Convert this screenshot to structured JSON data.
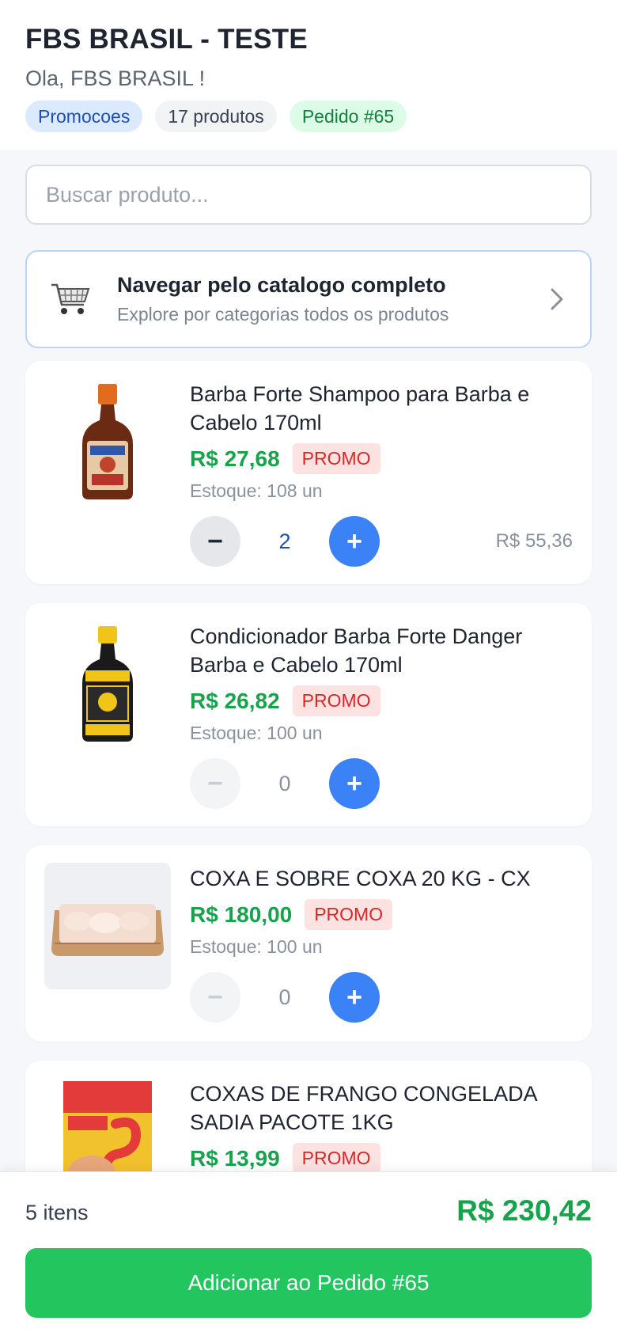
{
  "header": {
    "store_name": "FBS BRASIL - TESTE",
    "greeting": "Ola, FBS BRASIL !",
    "chips": [
      "Promocoes",
      "17 produtos",
      "Pedido #65"
    ]
  },
  "search": {
    "placeholder": "Buscar produto..."
  },
  "catalog": {
    "title": "Navegar pelo catalogo completo",
    "subtitle": "Explore por categorias todos os produtos"
  },
  "products": [
    {
      "name": "Barba Forte Shampoo para Barba e Cabelo 170ml",
      "price": "R$ 27,68",
      "badge": "PROMO",
      "stock": "Estoque: 108 un",
      "qty": "2",
      "subtotal": "R$ 55,36",
      "image": "shampoo-bottle"
    },
    {
      "name": "Condicionador Barba Forte Danger Barba e Cabelo 170ml",
      "price": "R$ 26,82",
      "badge": "PROMO",
      "stock": "Estoque: 100 un",
      "qty": "0",
      "image": "conditioner-bottle"
    },
    {
      "name": "COXA E SOBRE COXA 20 KG - CX",
      "price": "R$ 180,00",
      "badge": "PROMO",
      "stock": "Estoque: 100 un",
      "qty": "0",
      "image": "chicken-box"
    },
    {
      "name": "COXAS DE FRANGO CONGELADA SADIA PACOTE 1KG",
      "price": "R$ 13,99",
      "badge": "PROMO",
      "image": "sadia-package"
    }
  ],
  "footer": {
    "items_count": "5 itens",
    "total": "R$ 230,42",
    "submit_label": "Adicionar ao Pedido #65"
  },
  "controls": {
    "minus": "−",
    "plus": "+"
  },
  "colors": {
    "accent": "#3b82f6",
    "price_green": "#16a34a",
    "promo_red": "#dc2626",
    "submit_green": "#22c55e"
  }
}
